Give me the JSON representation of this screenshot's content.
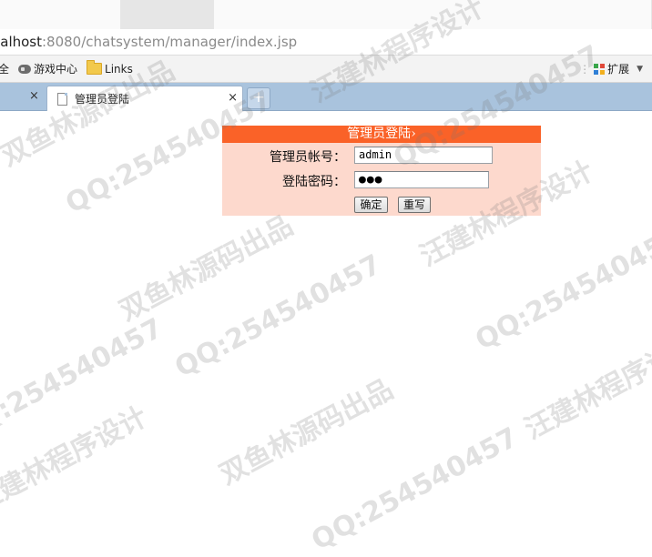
{
  "browser": {
    "url_host": "calhost",
    "url_rest": ":8080/chatsystem/manager/index.jsp",
    "bookmarks": [
      "全",
      "游戏中心",
      "Links"
    ],
    "extensions_label": "扩展",
    "tabs": [
      {
        "title": "管理员登陆",
        "active": true
      }
    ],
    "new_tab_label": "+",
    "close_label": "×"
  },
  "login": {
    "header": "管理员登陆",
    "header_arrow": "›",
    "username_label": "管理员帐号：",
    "username_value": "admin",
    "password_label": "登陆密码：",
    "password_value": "●●●",
    "confirm_label": "确定",
    "reset_label": "重写"
  },
  "watermarks": {
    "qq": "QQ:254540457",
    "studio": "双鱼林源码出品",
    "design": "汪建林程序设计"
  },
  "colors": {
    "header_bg": "#fa6228",
    "form_bg": "#fdd9cd",
    "tabbar_bg": "#a9c3dd"
  }
}
